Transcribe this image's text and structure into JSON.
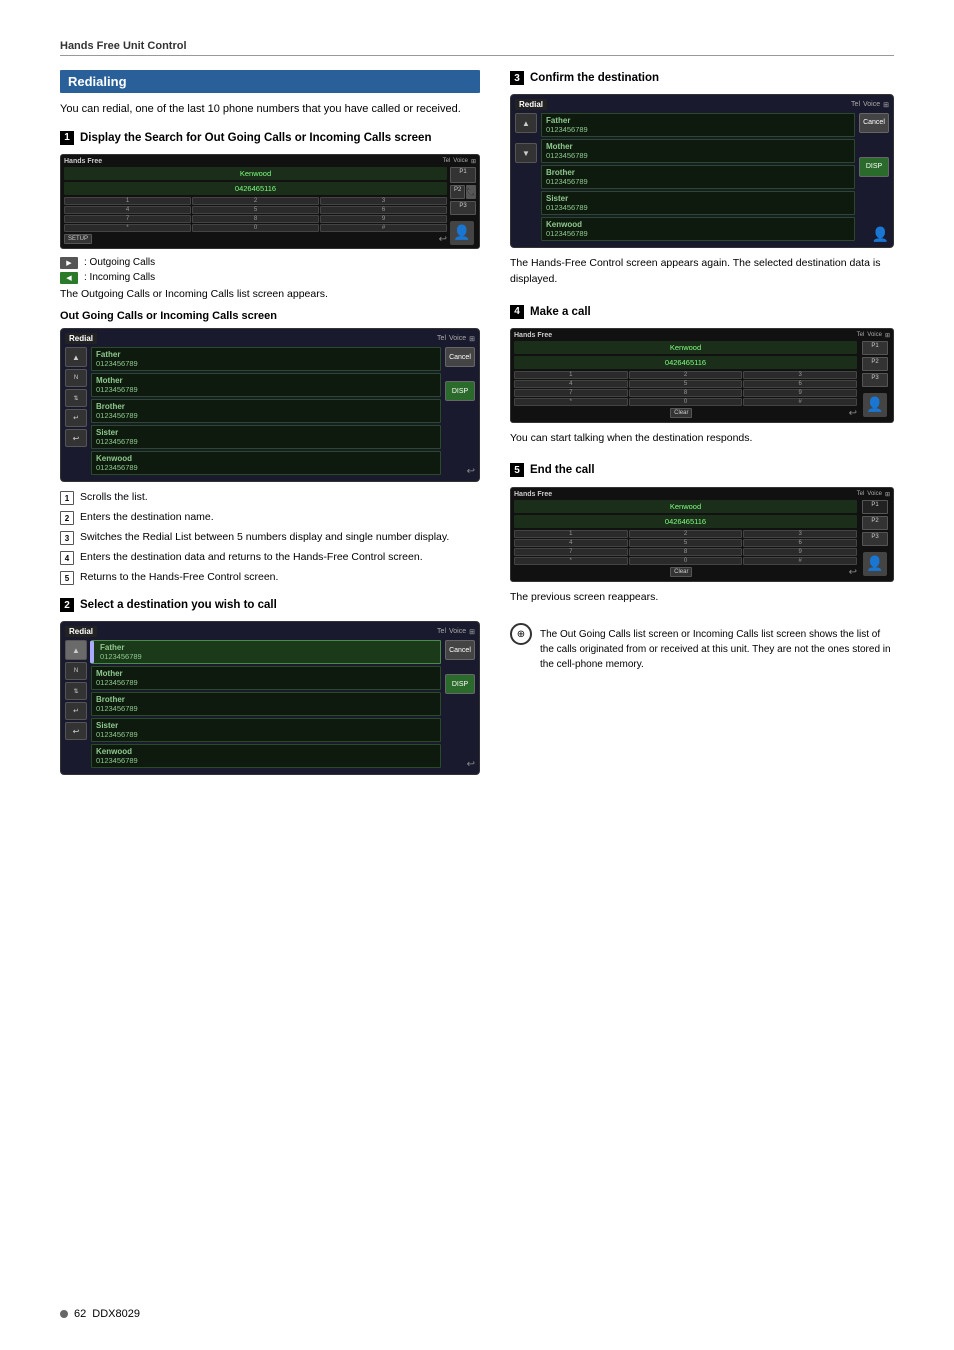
{
  "page": {
    "section_header": "Hands Free Unit Control",
    "footer_page": "62",
    "footer_model": "DDX8029"
  },
  "redialing": {
    "title": "Redialing",
    "intro": "You can redial, one of the last 10 phone numbers that you have called or received.",
    "step1": {
      "number": "1",
      "title": "Display the Search for Out Going Calls or Incoming Calls screen"
    },
    "hands_free_display": {
      "label": "Hands Free",
      "name": "Kenwood",
      "number": "0426465116",
      "buttons": [
        "P1",
        "P2",
        "P3"
      ],
      "bottom_btn": "SETUP"
    },
    "legend": [
      {
        "icon": "▶",
        "text": ": Outgoing Calls",
        "color": "dark"
      },
      {
        "icon": "◀",
        "text": ": Incoming Calls",
        "color": "green"
      }
    ],
    "legend_desc": "The Outgoing Calls or Incoming Calls list screen appears.",
    "outgoing_screen_title": "Out Going Calls or Incoming Calls screen",
    "redial_label": "Redial",
    "redial_entries": [
      {
        "name": "Father",
        "number": "0123456789"
      },
      {
        "name": "Mother",
        "number": "0123456789"
      },
      {
        "name": "Brother",
        "number": "0123456789"
      },
      {
        "name": "Sister",
        "number": "0123456789"
      },
      {
        "name": "Kenwood",
        "number": "0123456789"
      }
    ],
    "redial_right_buttons": [
      "Cancel",
      "DISP"
    ],
    "numbered_items": [
      "Scrolls the list.",
      "Enters the destination name.",
      "Switches the Redial List between 5 numbers display and single number display.",
      "Enters the destination data and returns to the Hands-Free Control screen.",
      "Returns to the Hands-Free Control screen."
    ],
    "step2": {
      "number": "2",
      "title": "Select a destination you wish to call"
    },
    "step2_entries": [
      {
        "name": "Father",
        "number": "0123456789",
        "selected": true
      },
      {
        "name": "Mother",
        "number": "0123456789"
      },
      {
        "name": "Brother",
        "number": "0123456789"
      },
      {
        "name": "Sister",
        "number": "0123456789"
      },
      {
        "name": "Kenwood",
        "number": "0123456789"
      }
    ]
  },
  "confirm": {
    "step_number": "3",
    "title": "Confirm the destination",
    "entries": [
      {
        "name": "Father",
        "number": "0123456789"
      },
      {
        "name": "Mother",
        "number": "0123456789"
      },
      {
        "name": "Brother",
        "number": "0123456789"
      },
      {
        "name": "Sister",
        "number": "0123456789"
      },
      {
        "name": "Kenwood",
        "number": "0123456789"
      }
    ],
    "buttons": [
      "Cancel",
      "DISP"
    ],
    "desc": "The Hands-Free Control screen appears again. The selected destination data is displayed."
  },
  "make_call": {
    "step_number": "4",
    "title": "Make a call",
    "display": {
      "label": "Hands Free",
      "name": "Kenwood",
      "number": "0426465116"
    },
    "desc": "You can start talking when the destination responds."
  },
  "end_call": {
    "step_number": "5",
    "title": "End the call",
    "display": {
      "label": "Hands Free",
      "name": "Kenwood",
      "number": "0426465116"
    },
    "desc": "The previous screen reappears."
  },
  "note": {
    "icon": "⊕",
    "text": "The Out Going Calls list screen or Incoming Calls list screen shows the list of the calls originated from or received at this unit. They are not the ones stored in the cell-phone memory."
  }
}
